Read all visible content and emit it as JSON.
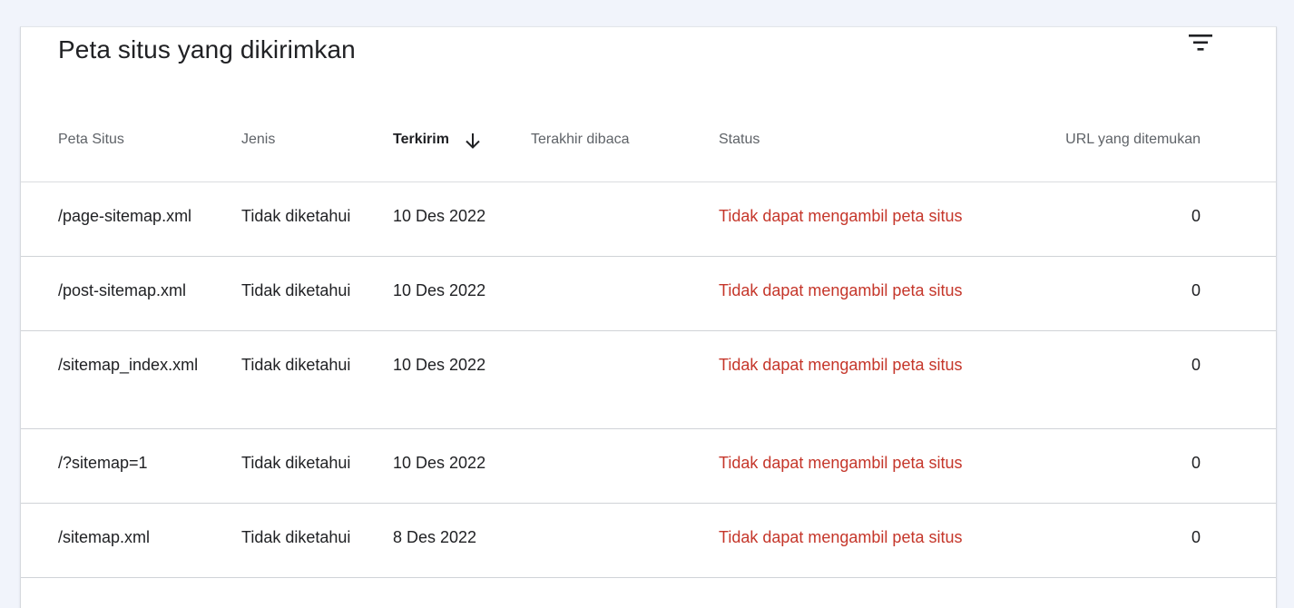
{
  "card": {
    "title": "Peta situs yang dikirimkan",
    "filter_icon": "filter-icon"
  },
  "table": {
    "columns": {
      "sitemap": "Peta Situs",
      "type": "Jenis",
      "submitted": "Terkirim",
      "last_read": "Terakhir dibaca",
      "status": "Status",
      "urls": "URL yang ditemukan"
    },
    "sort": {
      "column": "submitted",
      "direction": "descending",
      "icon": "arrow-down-icon"
    },
    "rows": [
      {
        "sitemap": "/page-sitemap.xml",
        "type": "Tidak diketahui",
        "submitted": "10 Des 2022",
        "last_read": "",
        "status": "Tidak dapat mengambil peta situs",
        "urls": "0"
      },
      {
        "sitemap": "/post-sitemap.xml",
        "type": "Tidak diketahui",
        "submitted": "10 Des 2022",
        "last_read": "",
        "status": "Tidak dapat mengambil peta situs",
        "urls": "0"
      },
      {
        "sitemap": "/sitemap_index.xml",
        "type": "Tidak diketahui",
        "submitted": "10 Des 2022",
        "last_read": "",
        "status": "Tidak dapat mengambil peta situs",
        "urls": "0"
      },
      {
        "sitemap": "/?sitemap=1",
        "type": "Tidak diketahui",
        "submitted": "10 Des 2022",
        "last_read": "",
        "status": "Tidak dapat mengambil peta situs",
        "urls": "0"
      },
      {
        "sitemap": "/sitemap.xml",
        "type": "Tidak diketahui",
        "submitted": "8 Des 2022",
        "last_read": "",
        "status": "Tidak dapat mengambil peta situs",
        "urls": "0"
      }
    ]
  },
  "colors": {
    "page_background": "#f1f4fb",
    "error_status": "#c5362a",
    "header_text": "#5f6368",
    "body_text": "#202124"
  }
}
